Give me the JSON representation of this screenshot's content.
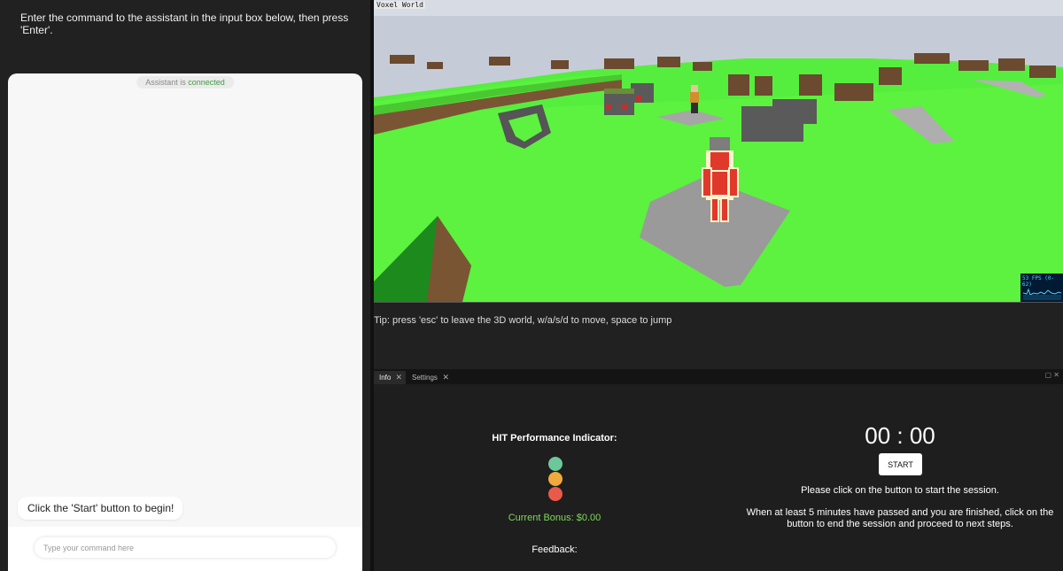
{
  "left_panel": {
    "instruction": "Enter the command to the assistant in the input box below, then press 'Enter'.",
    "status": {
      "prefix": "Assistant is ",
      "state": "connected"
    },
    "message": "Click the 'Start' button to begin!",
    "input_placeholder": "Type your command here"
  },
  "viewport": {
    "title": "Voxel World",
    "fps_label": "53 FPS (0-62)"
  },
  "tip": "Tip: press 'esc' to leave the 3D world, w/a/s/d to move, space to jump",
  "dock": {
    "tabs": [
      {
        "label": "Info"
      },
      {
        "label": "Settings"
      }
    ],
    "close_symbol": "✕",
    "controls": "▢ ✕"
  },
  "info": {
    "hit_title": "HIT Performance Indicator:",
    "bonus": "Current Bonus: $0.00",
    "feedback": "Feedback:",
    "timer": "00 : 00",
    "start_label": "START",
    "message1": "Please click on the button to start the session.",
    "message2": "When at least 5 minutes have passed and you are finished, click on the button to end the session and proceed to next steps.",
    "indicator_colors": [
      "#6cc89b",
      "#f0aa3c",
      "#ea5a4a"
    ]
  }
}
